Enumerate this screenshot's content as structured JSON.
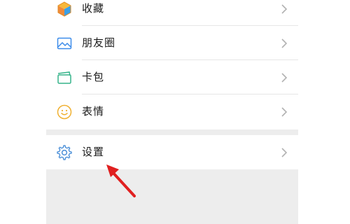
{
  "menu": {
    "items": [
      {
        "label": "收藏",
        "icon": "favorites-cube-icon"
      },
      {
        "label": "朋友圈",
        "icon": "moments-image-icon"
      },
      {
        "label": "卡包",
        "icon": "card-wallet-icon"
      },
      {
        "label": "表情",
        "icon": "sticker-smile-icon"
      }
    ],
    "settings": {
      "label": "设置",
      "icon": "gear-icon"
    }
  },
  "colors": {
    "favorites": "#f7b83a",
    "moments": "#3c8cea",
    "cards": "#35b38a",
    "stickers": "#f0b030",
    "settings": "#4a8fd8",
    "annotation_arrow": "#e02020",
    "background": "#ededed"
  }
}
